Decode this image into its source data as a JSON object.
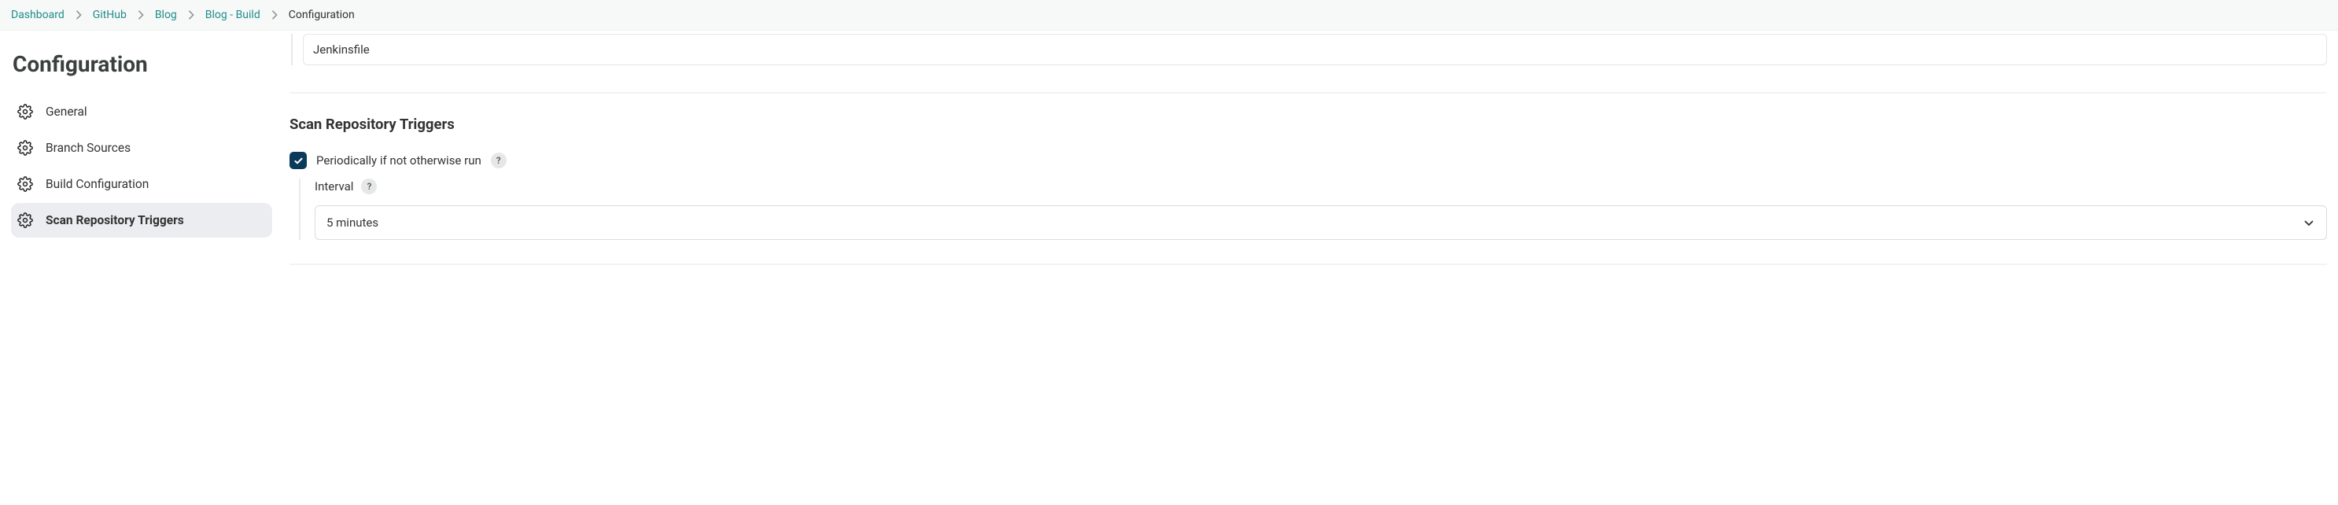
{
  "breadcrumb": {
    "items": [
      {
        "label": "Dashboard"
      },
      {
        "label": "GitHub"
      },
      {
        "label": "Blog"
      },
      {
        "label": "Blog - Build"
      }
    ],
    "current": "Configuration"
  },
  "page_title": "Configuration",
  "sidebar": {
    "items": [
      {
        "label": "General"
      },
      {
        "label": "Branch Sources"
      },
      {
        "label": "Build Configuration"
      },
      {
        "label": "Scan Repository Triggers"
      }
    ],
    "active_index": 3
  },
  "main": {
    "prev_input_value": "Jenkinsfile",
    "section_title": "Scan Repository Triggers",
    "checkbox": {
      "checked": true,
      "label": "Periodically if not otherwise run",
      "help": "?"
    },
    "interval": {
      "label": "Interval",
      "help": "?",
      "selected": "5 minutes"
    }
  }
}
